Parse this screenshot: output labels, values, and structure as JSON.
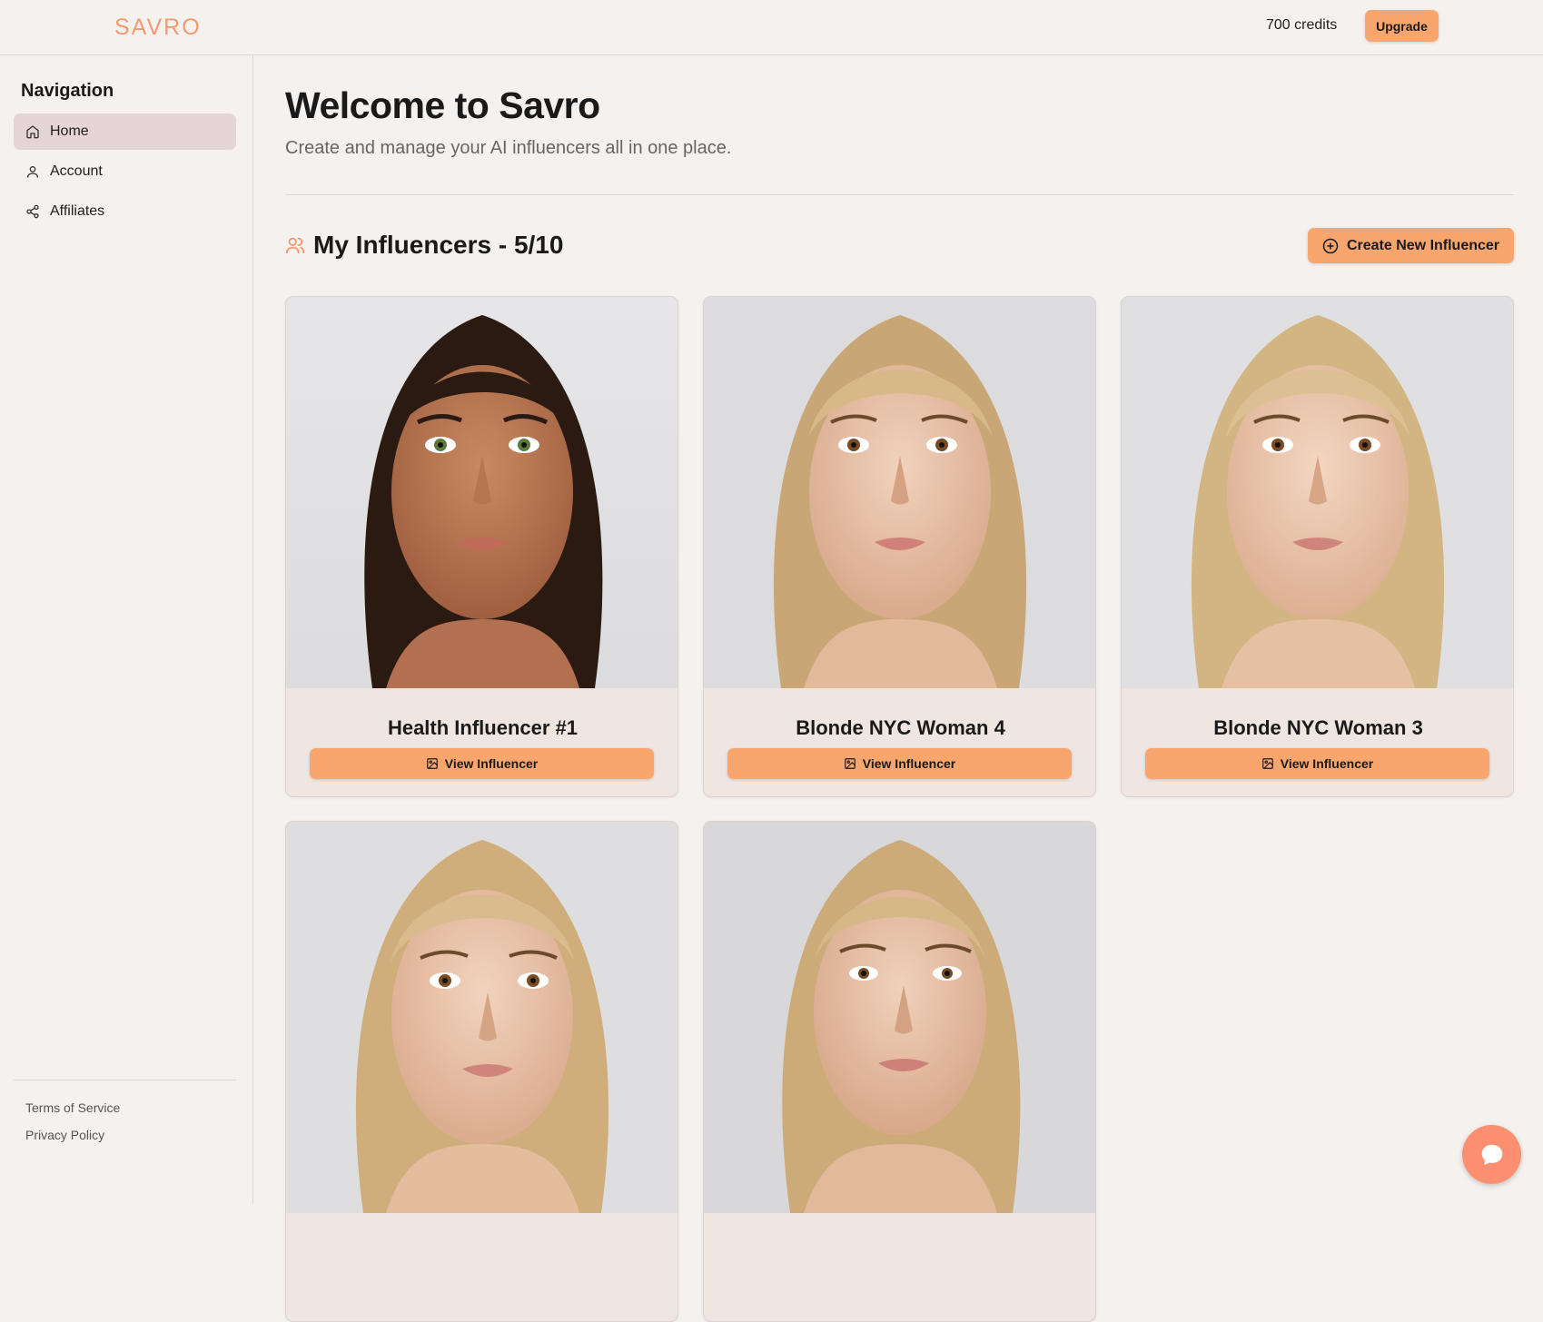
{
  "header": {
    "logo_text": "SAVRO",
    "credits_text": "700 credits",
    "upgrade_label": "Upgrade"
  },
  "sidebar": {
    "title": "Navigation",
    "items": [
      {
        "label": "Home",
        "icon": "home-icon",
        "active": true
      },
      {
        "label": "Account",
        "icon": "user-icon",
        "active": false
      },
      {
        "label": "Affiliates",
        "icon": "share-icon",
        "active": false
      }
    ],
    "footer_links": [
      "Terms of Service",
      "Privacy Policy"
    ]
  },
  "main": {
    "title": "Welcome to Savro",
    "subtitle": "Create and manage your AI influencers all in one place.",
    "section_title": "My Influencers - 5/10",
    "create_label": "Create New Influencer",
    "influencers": [
      {
        "name": "Health Influencer #1",
        "button": "View Influencer",
        "hair": "brunette"
      },
      {
        "name": "Blonde NYC Woman 4",
        "button": "View Influencer",
        "hair": "blonde"
      },
      {
        "name": "Blonde NYC Woman 3",
        "button": "View Influencer",
        "hair": "blonde"
      },
      {
        "name": "",
        "button": "",
        "hair": "blonde"
      },
      {
        "name": "",
        "button": "",
        "hair": "blonde"
      }
    ]
  },
  "colors": {
    "accent": "#f9a56e",
    "logo": "#f49a73",
    "active_nav": "#e5d4d8",
    "chat": "#fb8f6f"
  }
}
